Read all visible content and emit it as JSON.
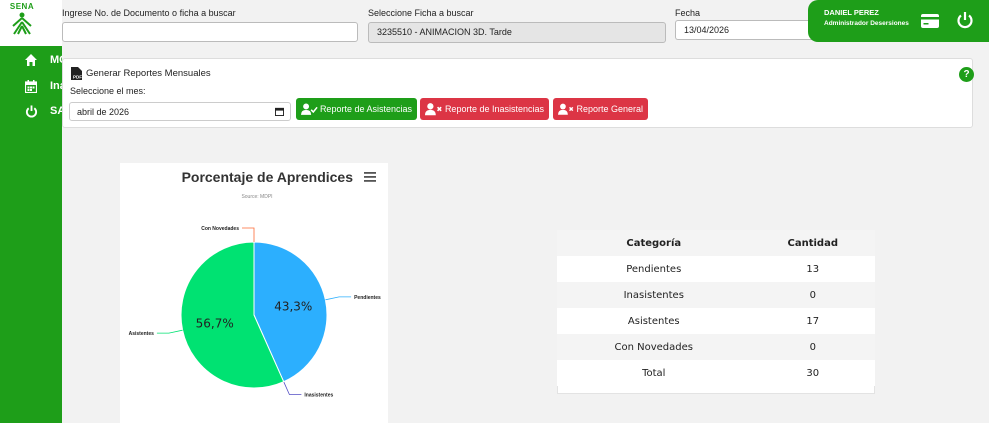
{
  "header": {
    "doc_label": "Ingrese No. de Documento o ficha a buscar",
    "ficha_label": "Seleccione Ficha a buscar",
    "ficha_value": "3235510 - ANIMACION 3D. Tarde",
    "fecha_label": "Fecha",
    "fecha_value": "13/04/2026"
  },
  "user": {
    "name": "DANIEL PEREZ",
    "role": "Administrador Desersiones"
  },
  "logo": {
    "text": "SENA"
  },
  "sidebar": {
    "items": [
      {
        "label": "MC",
        "icon": "home-icon"
      },
      {
        "label": "Ina",
        "icon": "calendar-icon"
      },
      {
        "label": "SA",
        "icon": "power-icon"
      }
    ]
  },
  "reports": {
    "title": "Generar Reportes Mensuales",
    "month_label": "Seleccione el mes:",
    "month_value": "abril de 2026",
    "btn_asistencias": "Reporte de Asistencias",
    "btn_inasistencias": "Reporte de Inasistencias",
    "btn_general": "Reporte General",
    "help": "?"
  },
  "colors": {
    "brand_green": "#1e9e19",
    "danger_red": "#dc3545",
    "pie_asistentes": "#00e272",
    "pie_pendientes": "#2caffe",
    "pie_inasistentes": "#544fc5",
    "pie_novedades": "#fe6a35"
  },
  "chart_data": {
    "type": "pie",
    "title": "Porcentaje de Aprendices",
    "subtitle": "Source: MDPI",
    "slices": [
      {
        "name": "Pendientes",
        "value": 13,
        "label": "43,3%"
      },
      {
        "name": "Inasistentes",
        "value": 0,
        "label": ""
      },
      {
        "name": "Asistentes",
        "value": 17,
        "label": "56,7%"
      },
      {
        "name": "Con Novedades",
        "value": 0,
        "label": ""
      }
    ]
  },
  "table": {
    "headers": [
      "Categoría",
      "Cantidad"
    ],
    "rows": [
      [
        "Pendientes",
        "13"
      ],
      [
        "Inasistentes",
        "0"
      ],
      [
        "Asistentes",
        "17"
      ],
      [
        "Con Novedades",
        "0"
      ],
      [
        "Total",
        "30"
      ]
    ]
  }
}
